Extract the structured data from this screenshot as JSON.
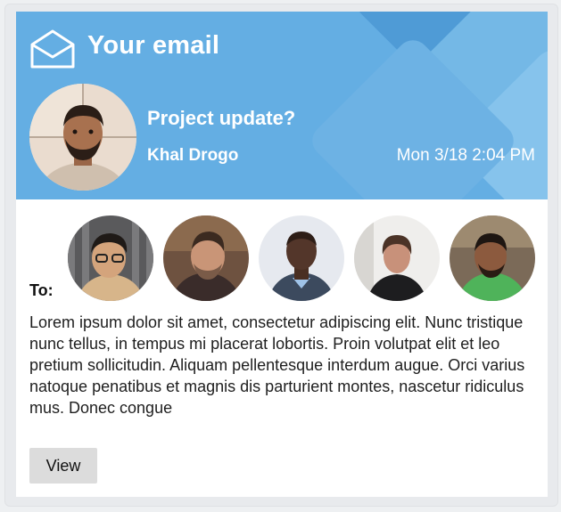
{
  "header": {
    "title": "Your email",
    "icon": "envelope-open-icon",
    "background": "#64aee3"
  },
  "email": {
    "subject": "Project update?",
    "sender_name": "Khal Drogo",
    "datetime": "Mon 3/18 2:04 PM"
  },
  "recipients": {
    "label": "To:",
    "count": 5
  },
  "body": {
    "text": "Lorem ipsum dolor sit amet, consectetur adipiscing elit. Nunc tristique nunc tellus, in tempus mi placerat lobortis. Proin volutpat elit et leo pretium sollicitudin. Aliquam pellentesque interdum augue. Orci varius natoque penatibus et magnis dis parturient montes, nascetur ridiculus mus. Donec congue"
  },
  "actions": {
    "view_label": "View"
  }
}
